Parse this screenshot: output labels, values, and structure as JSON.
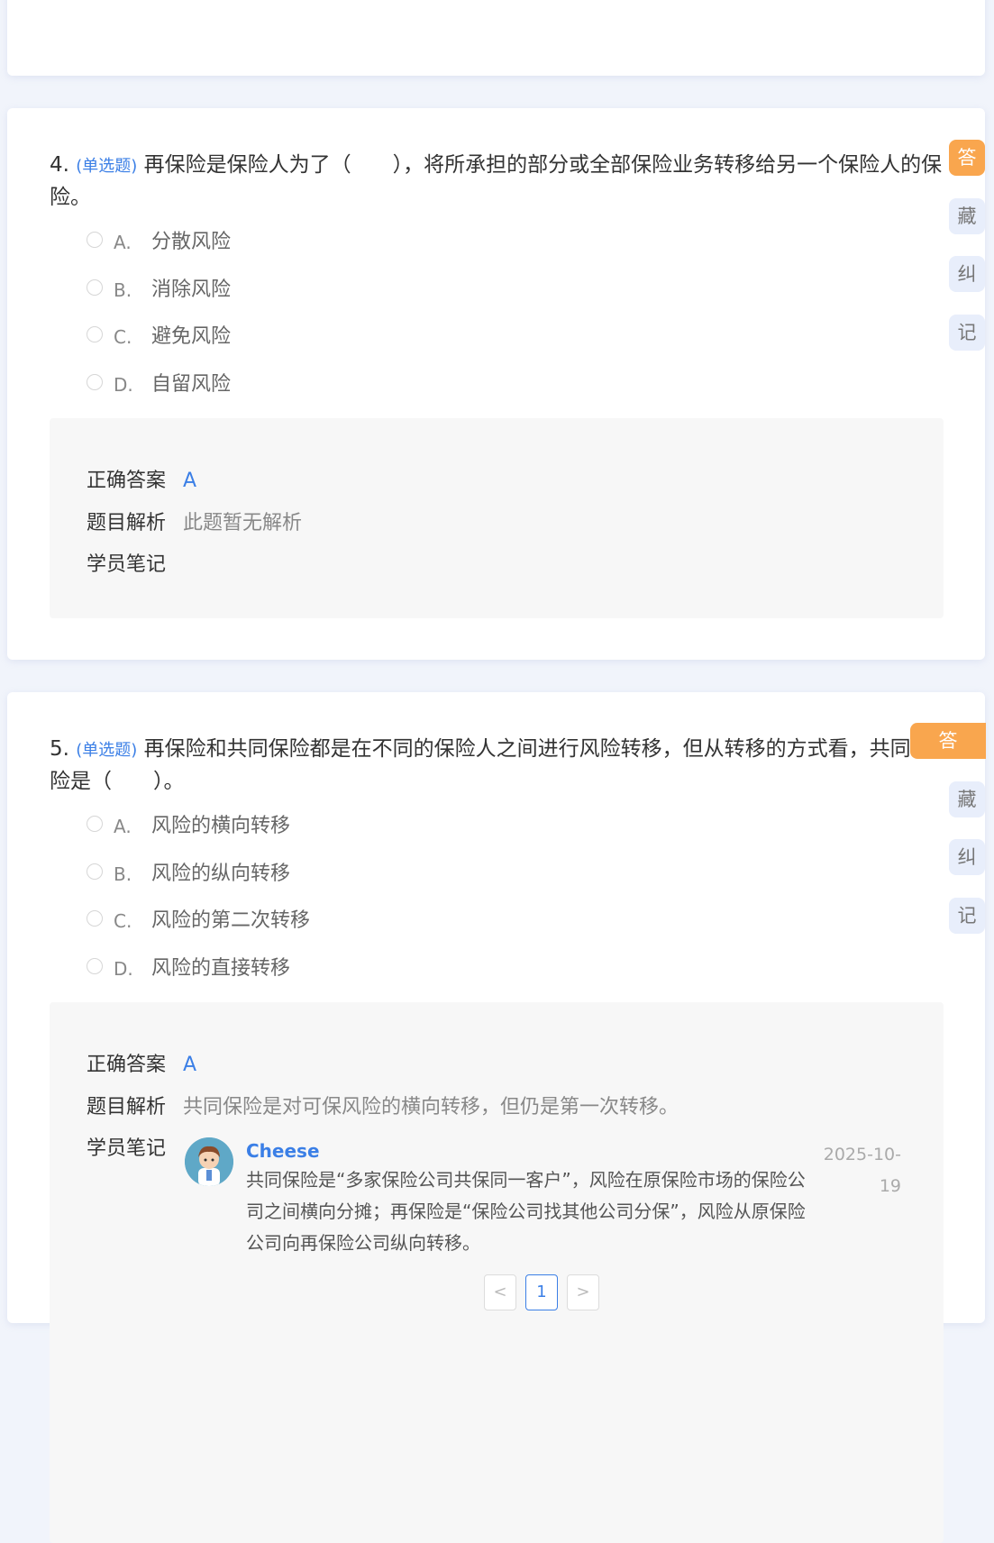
{
  "questions": [
    {
      "number": "4.",
      "type": "(单选题)",
      "text": "再保险是保险人为了（　　），将所承担的部分或全部保险业务转移给另一个保险人的保险。",
      "options": [
        {
          "letter": "A.",
          "text": "分散风险"
        },
        {
          "letter": "B.",
          "text": "消除风险"
        },
        {
          "letter": "C.",
          "text": "避免风险"
        },
        {
          "letter": "D.",
          "text": "自留风险"
        }
      ],
      "answer_label": "正确答案",
      "answer": "A",
      "analysis_label": "题目解析",
      "analysis": "此题暂无解析",
      "notes_label": "学员笔记"
    },
    {
      "number": "5.",
      "type": "(单选题)",
      "text": "再保险和共同保险都是在不同的保险人之间进行风险转移，但从转移的方式看，共同保险是（　　）。",
      "options": [
        {
          "letter": "A.",
          "text": "风险的横向转移"
        },
        {
          "letter": "B.",
          "text": "风险的纵向转移"
        },
        {
          "letter": "C.",
          "text": "风险的第二次转移"
        },
        {
          "letter": "D.",
          "text": "风险的直接转移"
        }
      ],
      "answer_label": "正确答案",
      "answer": "A",
      "analysis_label": "题目解析",
      "analysis": "共同保险是对可保风险的横向转移，但仍是第一次转移。",
      "notes_label": "学员笔记",
      "note": {
        "user": "Cheese",
        "date": "2025-10-19",
        "text": "共同保险是“多家保险公司共保同一客户”，风险在原保险市场的保险公司之间横向分摊；再保险是“保险公司找其他公司分保”，风险从原保险公司向再保险公司纵向转移。"
      },
      "pagination": {
        "prev": "<",
        "page": "1",
        "next": ">"
      }
    }
  ],
  "side_buttons": {
    "answer": "答",
    "collect": "藏",
    "correct": "纠",
    "note": "记"
  },
  "colors": {
    "accent": "#3b7fe6",
    "answer_button": "#f9a64e",
    "side_button_bg": "#e8eefb"
  }
}
